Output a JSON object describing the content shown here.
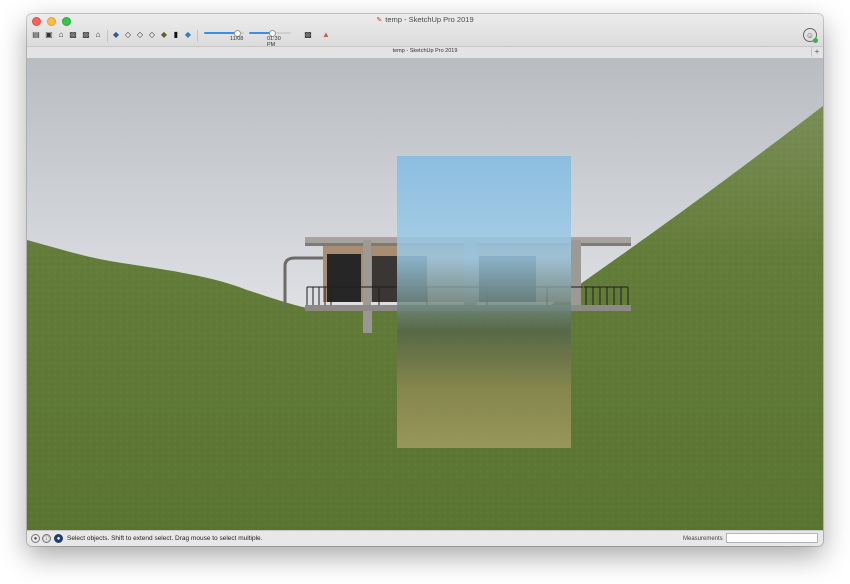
{
  "window": {
    "title": "temp - SketchUp Pro 2019",
    "tab_title": "temp - SketchUp Pro 2019",
    "tab_add": "+"
  },
  "toolbar": {
    "shadow_date_value": "11/08",
    "shadow_time_value": "01:30 PM",
    "shadow_date_fraction": 0.82,
    "shadow_time_fraction": 0.55,
    "icons": [
      "iso-view-icon",
      "top-view-icon",
      "front-view-icon",
      "right-view-icon",
      "back-view-icon",
      "left-view-icon",
      "xray-style-icon",
      "wireframe-style-icon",
      "hidden-line-style-icon",
      "shaded-style-icon",
      "shaded-texture-style-icon",
      "monochrome-style-icon",
      "shadows-toggle-icon",
      "shadow-settings-icon",
      "fog-icon",
      "section-plane-icon"
    ]
  },
  "status": {
    "instruction": "Select objects. Shift to extend select. Drag mouse to select multiple.",
    "measurements_label": "Measurements",
    "measurements_value": ""
  },
  "colors": {
    "sky_top": "#b9bcc1",
    "sky_bottom": "#eef0f3",
    "grass": "#5f7a34",
    "selection_plane": "#8fc4e6"
  }
}
